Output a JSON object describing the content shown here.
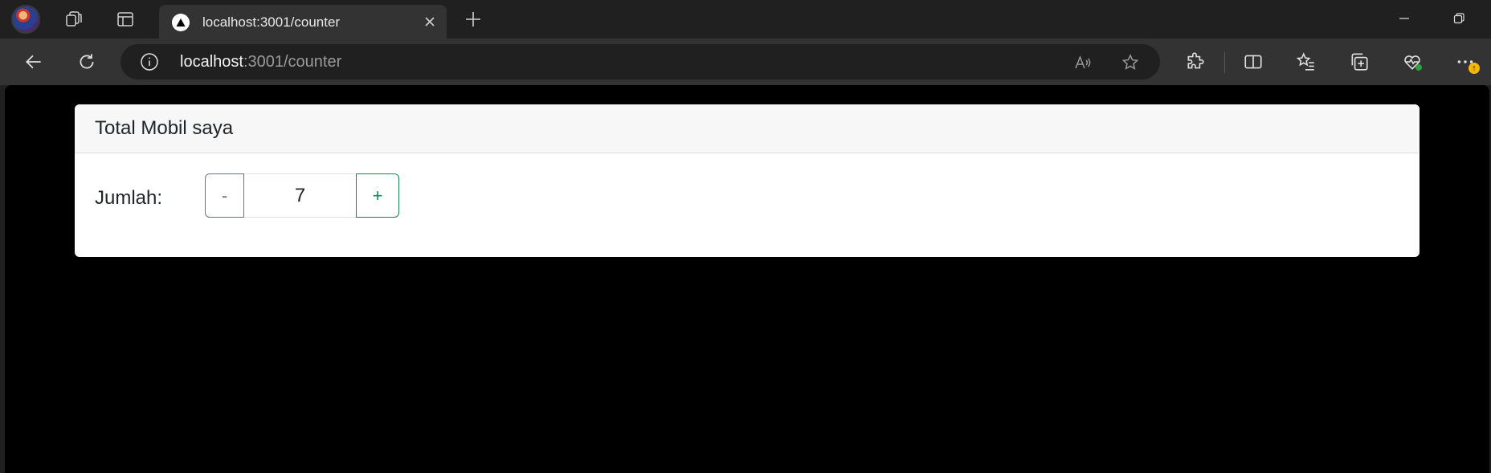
{
  "browser": {
    "tab": {
      "title": "localhost:3001/counter",
      "favicon": "triangle-logo-icon"
    },
    "address_bar": {
      "url_host": "localhost",
      "url_path": ":3001/counter"
    },
    "update_badge": "↑",
    "colors": {
      "tab_bar": "#202020",
      "toolbar": "#333333",
      "badge": "#f5b800"
    }
  },
  "page": {
    "card_title": "Total Mobil saya",
    "quantity_label": "Jumlah:",
    "minus_label": "-",
    "quantity_value": "7",
    "plus_label": "+",
    "colors": {
      "page_background": "#000000",
      "minus_border": "#6c757d",
      "plus_accent": "#198754"
    }
  }
}
